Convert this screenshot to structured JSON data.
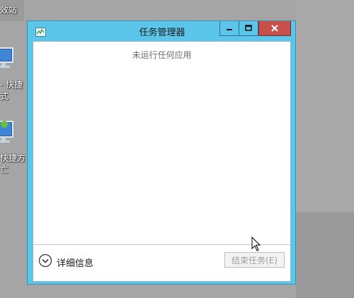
{
  "desktop": {
    "label_top": "效站",
    "shortcut1_line1": "- 快捷",
    "shortcut1_line2": "式",
    "shortcut2_line1": "快捷方",
    "shortcut2_line2": "亡"
  },
  "window": {
    "title": "任务管理器",
    "empty_message": "未运行任何应用",
    "details_label": "详细信息",
    "end_task_label": "结束任务(E)",
    "close_color": "#c7504a",
    "frame_color": "#5cc6ea"
  },
  "icons": [
    "task-manager-app-icon",
    "minimize-icon",
    "maximize-icon",
    "close-icon",
    "chevron-down-circle-icon",
    "computer-icon",
    "network-computer-icon",
    "mouse-cursor-icon"
  ]
}
